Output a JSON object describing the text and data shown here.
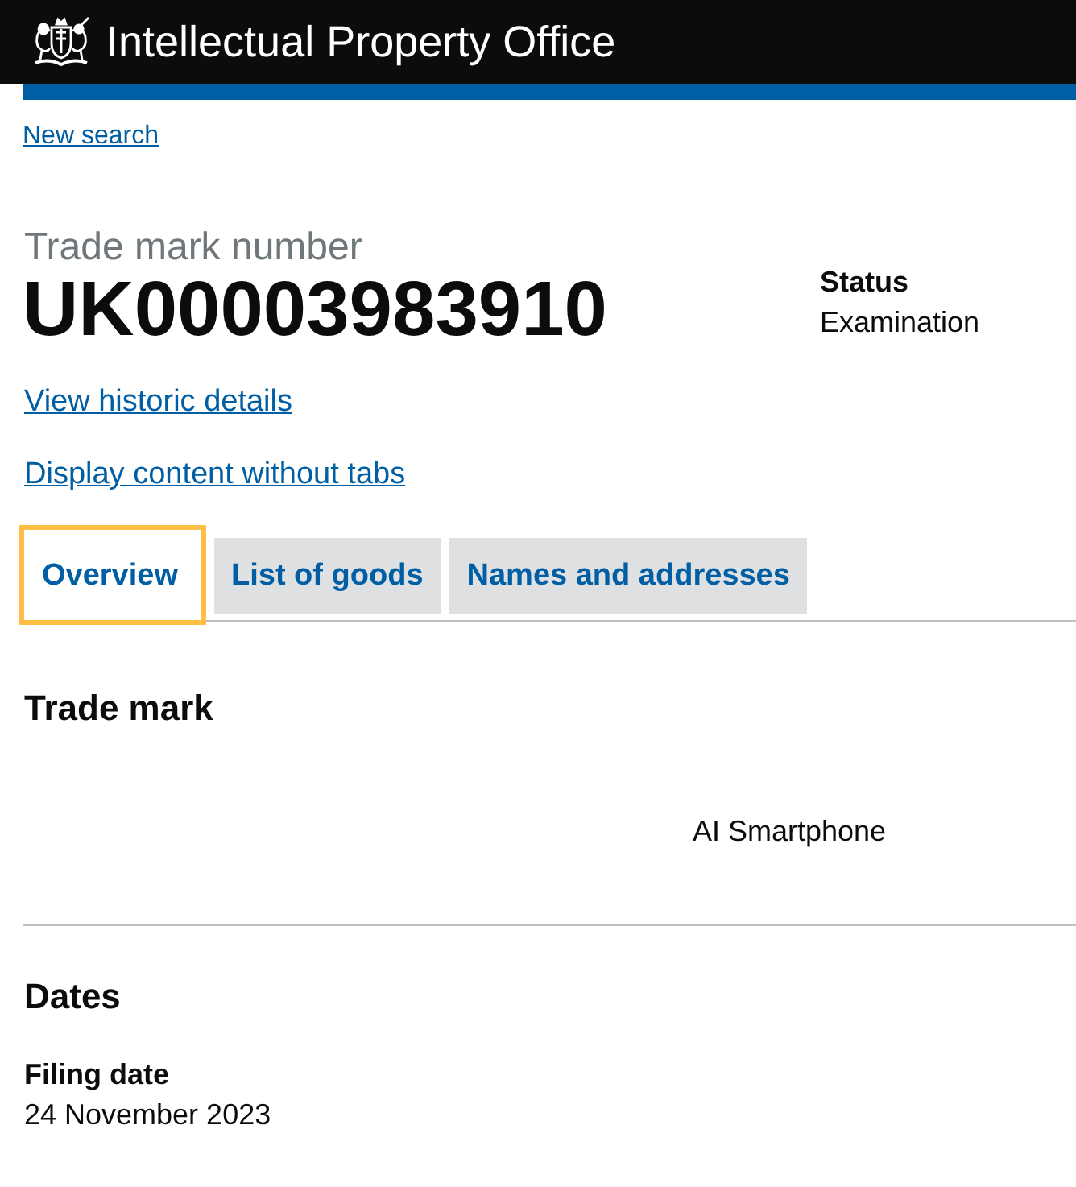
{
  "header": {
    "title": "Intellectual Property Office"
  },
  "new_search_link": "New search",
  "trade_mark": {
    "caption": "Trade mark number",
    "number": "UK00003983910"
  },
  "status": {
    "label": "Status",
    "value": "Examination"
  },
  "links": [
    "View historic details",
    "Display content without tabs"
  ],
  "tabs": [
    {
      "label": "Overview",
      "selected": true
    },
    {
      "label": "List of goods",
      "selected": false
    },
    {
      "label": "Names and addresses",
      "selected": false
    }
  ],
  "sections": [
    {
      "kind": "mark",
      "heading": "Trade mark",
      "text": "AI Smartphone"
    },
    {
      "kind": "fields",
      "heading": "Dates",
      "fields": [
        {
          "label": "Filing date",
          "value": "24 November 2023"
        }
      ]
    }
  ]
}
